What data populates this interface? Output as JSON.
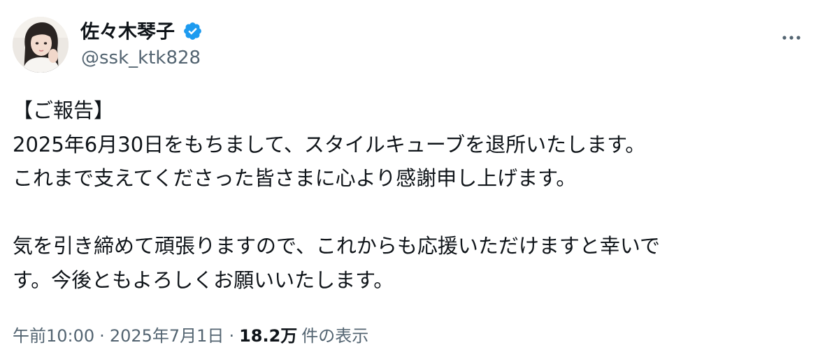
{
  "author": {
    "display_name": "佐々木琴子",
    "handle": "@ssk_ktk828",
    "verified": true
  },
  "tweet": {
    "lines": [
      "【ご報告】",
      "2025年6月30日をもちまして、スタイルキューブを退所いたします。",
      "これまで支えてくださった皆さまに心より感謝申し上げます。",
      "",
      "気を引き締めて頑張りますので、これからも応援いただけますと幸いで",
      "す。今後ともよろしくお願いいたします。"
    ]
  },
  "meta": {
    "time": "午前10:00",
    "separator": "·",
    "date": "2025年7月1日",
    "views_count": "18.2万",
    "views_label": "件の表示"
  },
  "icons": {
    "verified": "verified-badge-icon",
    "more": "more-options-icon"
  },
  "colors": {
    "text_primary": "#0f1419",
    "text_secondary": "#536471",
    "verified_blue": "#1d9bf0"
  }
}
